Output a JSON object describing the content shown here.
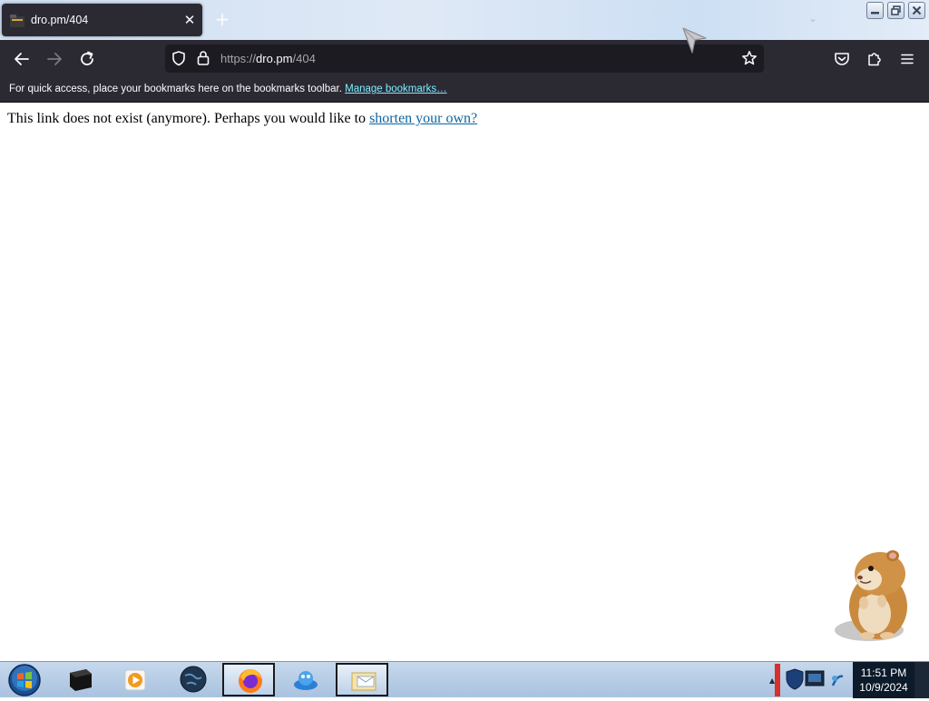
{
  "browser": {
    "tab": {
      "title": "dro.pm/404",
      "close_glyph": "✕",
      "favicon": "folder-icon"
    },
    "new_tab_glyph": "+",
    "nav": {
      "back_icon": "arrow-left-icon",
      "forward_icon": "arrow-right-icon",
      "reload_icon": "reload-icon",
      "url_scheme": "https://",
      "url_host": "dro.pm",
      "url_path": "/404",
      "shield_icon": "shield-icon",
      "lock_icon": "lock-icon",
      "bookmark_star_icon": "star-icon",
      "pocket_icon": "pocket-icon",
      "extensions_icon": "puzzle-icon",
      "menu_icon": "hamburger-icon"
    },
    "bookmarks_bar": {
      "text": "For quick access, place your bookmarks here on the bookmarks toolbar.",
      "link": "Manage bookmarks…"
    }
  },
  "page": {
    "message": "This link does not exist (anymore). Perhaps you would like to",
    "link": "shorten your own?"
  },
  "taskbar": {
    "clock_time": "11:51 PM",
    "clock_date": "10/9/2024",
    "apps": [
      "terminal-icon",
      "media-player-icon",
      "globe-icon",
      "firefox-icon",
      "paint-icon",
      "mail-icon"
    ]
  },
  "colors": {
    "toolbar": "#2b2a33",
    "urlbar": "#1c1b22",
    "link": "#0a66a0",
    "bookmark_link": "#80ebff"
  }
}
